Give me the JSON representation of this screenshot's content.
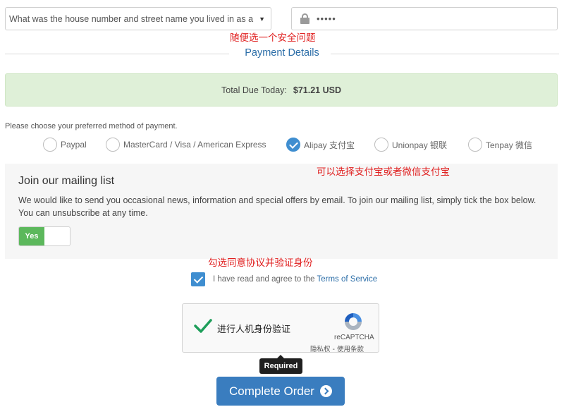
{
  "security": {
    "question_value": "What was the house number and street name you lived in as a c",
    "answer_masked": "•••••"
  },
  "annotations": {
    "security_hint": "随便选一个安全问题",
    "payment_hint": "可以选择支付宝或者微信支付宝",
    "agree_hint": "勾选同意协议并验证身份"
  },
  "payment": {
    "section_title": "Payment Details",
    "total_label": "Total Due Today:",
    "total_amount": "$71.21 USD",
    "choose_prompt": "Please choose your preferred method of payment.",
    "methods": [
      {
        "label": "Paypal",
        "selected": false
      },
      {
        "label": "MasterCard / Visa / American Express",
        "selected": false
      },
      {
        "label": "Alipay 支付宝",
        "selected": true
      },
      {
        "label": "Unionpay 银联",
        "selected": false
      },
      {
        "label": "Tenpay 微信",
        "selected": false
      }
    ]
  },
  "mailing": {
    "title": "Join our mailing list",
    "description": "We would like to send you occasional news, information and special offers by email. To join our mailing list, simply tick the box below. You can unsubscribe at any time.",
    "toggle_label": "Yes"
  },
  "tos": {
    "text": "I have read and agree to the",
    "link": "Terms of Service"
  },
  "captcha": {
    "label": "进行人机身份验证",
    "brand": "reCAPTCHA",
    "links": "隐私权 - 使用条款"
  },
  "tooltip": "Required",
  "submit_label": "Complete Order",
  "colors": {
    "accent": "#3a7dbf",
    "checked": "#3f8ed0",
    "success_bg": "#dff0d8",
    "annotation": "#e02020",
    "toggle_on": "#5cb85c"
  }
}
